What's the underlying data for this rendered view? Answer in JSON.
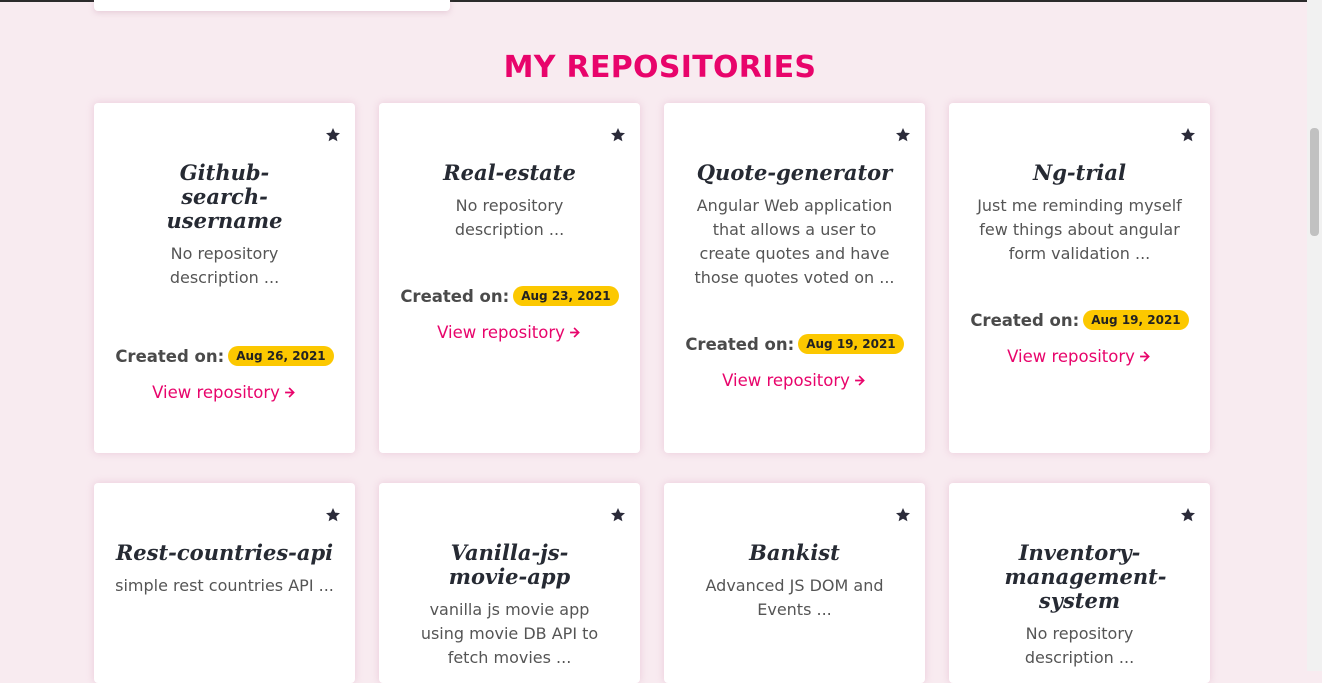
{
  "section": {
    "title": "MY REPOSITORIES"
  },
  "repos": [
    {
      "name": "Github-search-username",
      "description": "No repository description ...",
      "created_label": "Created on:",
      "date": "Aug 26, 2021",
      "link_label": "View repository"
    },
    {
      "name": "Real-estate",
      "description": "No repository description ...",
      "created_label": "Created on:",
      "date": "Aug 23, 2021",
      "link_label": "View repository"
    },
    {
      "name": "Quote-generator",
      "description": "Angular Web application that allows a user to create quotes and have those quotes voted on ...",
      "created_label": "Created on:",
      "date": "Aug 19, 2021",
      "link_label": "View repository"
    },
    {
      "name": "Ng-trial",
      "description": "Just me reminding myself few things about angular form validation ...",
      "created_label": "Created on:",
      "date": "Aug 19, 2021",
      "link_label": "View repository"
    },
    {
      "name": "Rest-countries-api",
      "description": "simple rest countries API ..."
    },
    {
      "name": "Vanilla-js-movie-app",
      "description": "vanilla js movie app using movie DB API to fetch movies ..."
    },
    {
      "name": "Bankist",
      "description": "Advanced JS DOM and Events ..."
    },
    {
      "name": "Inventory-management-system",
      "description": "No repository description ..."
    }
  ],
  "icons": {
    "star": "star-icon",
    "arrow": "arrow-right-icon"
  },
  "colors": {
    "accent": "#e8046b",
    "badge": "#fcc800",
    "background": "#f8ebf0"
  }
}
